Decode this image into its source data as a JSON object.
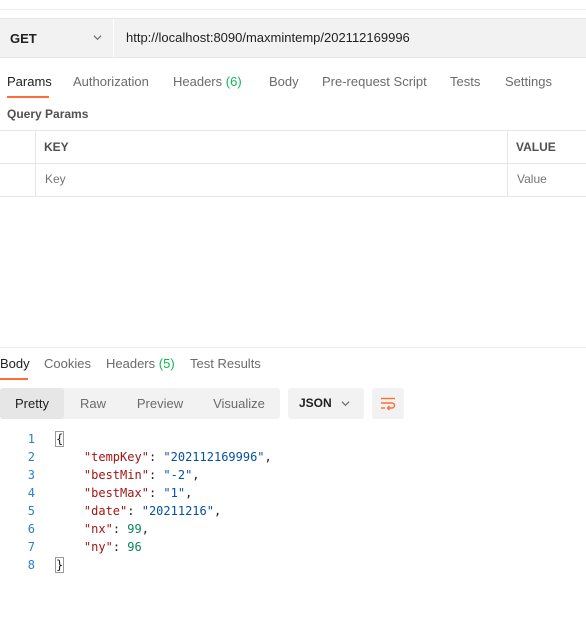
{
  "request": {
    "method": "GET",
    "url": "http://localhost:8090/maxmintemp/202112169996"
  },
  "request_tabs": {
    "params": "Params",
    "authorization": "Authorization",
    "headers": "Headers",
    "headers_count": "(6)",
    "body": "Body",
    "prerequest": "Pre-request Script",
    "tests": "Tests",
    "settings": "Settings"
  },
  "query_params": {
    "label": "Query Params",
    "key_header": "KEY",
    "value_header": "VALUE",
    "key_placeholder": "Key",
    "value_placeholder": "Value"
  },
  "response_tabs": {
    "body": "Body",
    "cookies": "Cookies",
    "headers": "Headers",
    "headers_count": "(5)",
    "test_results": "Test Results"
  },
  "view_modes": {
    "pretty": "Pretty",
    "raw": "Raw",
    "preview": "Preview",
    "visualize": "Visualize",
    "selected": "Pretty"
  },
  "format": "JSON",
  "icons": {
    "method_dropdown": "chevron-down-icon",
    "format_dropdown": "chevron-down-icon",
    "wrap": "wrap-lines-icon"
  },
  "colors": {
    "accent": "#ff6c37",
    "count": "#0cbb52",
    "line_numbers": "#2a82c6",
    "json_key": "#a31515",
    "json_string": "#0451a5",
    "json_number": "#098658"
  },
  "response_lines": [
    {
      "num": "1",
      "open": "{"
    },
    {
      "num": "2",
      "key": "\"tempKey\"",
      "value": "\"202112169996\"",
      "type": "string",
      "comma": ","
    },
    {
      "num": "3",
      "key": "\"bestMin\"",
      "value": "\"-2\"",
      "type": "string",
      "comma": ","
    },
    {
      "num": "4",
      "key": "\"bestMax\"",
      "value": "\"1\"",
      "type": "string",
      "comma": ","
    },
    {
      "num": "5",
      "key": "\"date\"",
      "value": "\"20211216\"",
      "type": "string",
      "comma": ","
    },
    {
      "num": "6",
      "key": "\"nx\"",
      "value": "99",
      "type": "number",
      "comma": ","
    },
    {
      "num": "7",
      "key": "\"ny\"",
      "value": "96",
      "type": "number",
      "comma": ""
    },
    {
      "num": "8",
      "close": "}"
    }
  ]
}
